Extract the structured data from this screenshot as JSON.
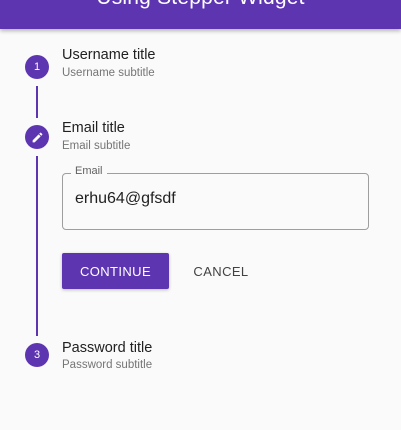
{
  "app_bar": {
    "title": "Using Stepper Widget"
  },
  "stepper": {
    "steps": [
      {
        "number": "1",
        "title": "Username title",
        "subtitle": "Username subtitle",
        "state": "indexed"
      },
      {
        "title": "Email title",
        "subtitle": "Email subtitle",
        "state": "editing",
        "icon": "pencil-icon"
      },
      {
        "number": "3",
        "title": "Password title",
        "subtitle": "Password subtitle",
        "state": "indexed"
      }
    ],
    "email_field": {
      "label": "Email",
      "value": "erhu64@gfsdf"
    },
    "controls": {
      "continue_label": "CONTINUE",
      "cancel_label": "CANCEL"
    }
  },
  "colors": {
    "primary": "#5e35b1",
    "background": "#fafafa"
  }
}
